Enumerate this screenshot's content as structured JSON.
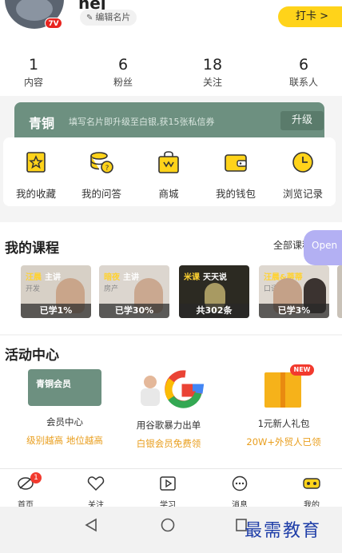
{
  "header": {
    "username": "hej",
    "vip_badge": "7V",
    "edit_card": "编辑名片",
    "checkin": "打卡 >"
  },
  "stats": [
    {
      "value": "1",
      "label": "内容"
    },
    {
      "value": "6",
      "label": "粉丝"
    },
    {
      "value": "18",
      "label": "关注"
    },
    {
      "value": "6",
      "label": "联系人"
    }
  ],
  "membership": {
    "level": "青铜",
    "tip": "填写名片即升级至白银,获15张私信券",
    "upgrade": "升级"
  },
  "tools": [
    {
      "label": "我的收藏",
      "icon": "star-bookmark-icon"
    },
    {
      "label": "我的问答",
      "icon": "qa-coins-icon"
    },
    {
      "label": "商城",
      "icon": "shopping-bag-icon"
    },
    {
      "label": "我的钱包",
      "icon": "wallet-icon"
    },
    {
      "label": "浏览记录",
      "icon": "clock-icon"
    }
  ],
  "courses": {
    "title": "我的课程",
    "all": "全部课程 >",
    "open_tab": "Open",
    "items": [
      {
        "tag": "汪晨",
        "tag2": "主讲",
        "sub": "开发",
        "progress": "已学1%"
      },
      {
        "tag": "暗夜",
        "tag2": "主讲",
        "sub": "房产",
        "progress": "已学30%"
      },
      {
        "tag": "米课",
        "tag2": "天天说",
        "sub": "",
        "progress": "共302条"
      },
      {
        "tag": "汪晨&蒂蒂",
        "tag2": "",
        "sub": "口语",
        "progress": "已学3%"
      }
    ]
  },
  "activity": {
    "title": "活动中心",
    "items": [
      {
        "line1": "会员中心",
        "line2": "级别越高 地位越高",
        "card": "青铜会员"
      },
      {
        "line1": "用谷歌暴力出单",
        "line2": "白银会员免费领",
        "card": ""
      },
      {
        "line1": "1元新人礼包",
        "line2": "20W+外贸人已领",
        "card": "NEW"
      }
    ]
  },
  "tabbar": [
    {
      "label": "首页",
      "icon": "home-icon",
      "badge": "1"
    },
    {
      "label": "关注",
      "icon": "heart-icon",
      "badge": ""
    },
    {
      "label": "学习",
      "icon": "play-icon",
      "badge": ""
    },
    {
      "label": "消息",
      "icon": "message-icon",
      "badge": ""
    },
    {
      "label": "我的",
      "icon": "profile-icon",
      "badge": ""
    }
  ],
  "watermark": "最需教育",
  "colors": {
    "accent": "#ffd31a",
    "bronze": "#6d9080",
    "orange_text": "#e99e1d",
    "badge_red": "#f23a2e"
  }
}
